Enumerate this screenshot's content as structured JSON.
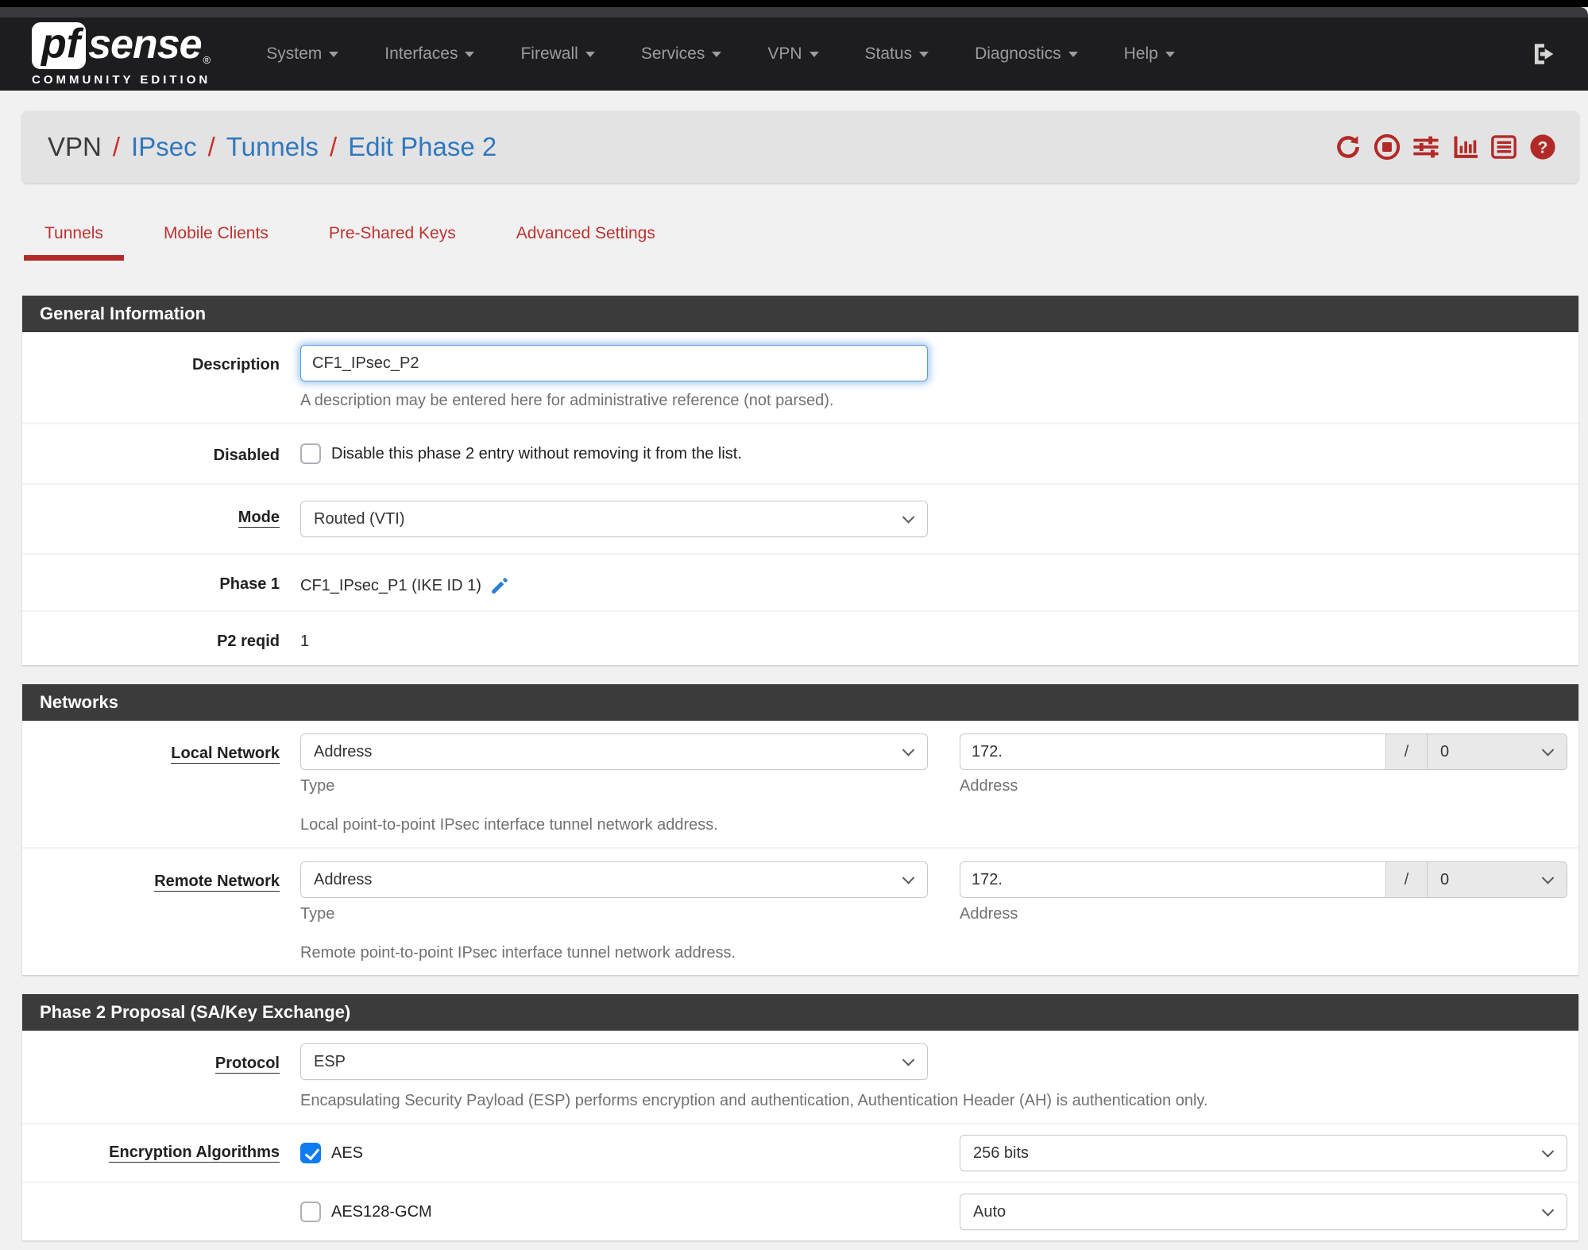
{
  "colors": {
    "accent_red": "#b22a27",
    "link_blue": "#3178be",
    "checkbox_blue": "#0e7bf0",
    "panel_header_bg": "#3b3b3b",
    "navbar_bg": "#1d1d1f"
  },
  "navbar": {
    "brand_pf": "pf",
    "brand_sense": "sense",
    "brand_reg": "®",
    "brand_edition": "COMMUNITY EDITION",
    "items": [
      {
        "label": "System"
      },
      {
        "label": "Interfaces"
      },
      {
        "label": "Firewall"
      },
      {
        "label": "Services"
      },
      {
        "label": "VPN"
      },
      {
        "label": "Status"
      },
      {
        "label": "Diagnostics"
      },
      {
        "label": "Help"
      }
    ]
  },
  "breadcrumb": {
    "sep": "/",
    "items": [
      {
        "label": "VPN"
      },
      {
        "label": "IPsec"
      },
      {
        "label": "Tunnels"
      },
      {
        "label": "Edit Phase 2"
      }
    ],
    "action_icons": [
      "refresh-icon",
      "stop-circle-icon",
      "sliders-icon",
      "bar-chart-icon",
      "list-icon",
      "help-icon"
    ]
  },
  "tabs": [
    {
      "label": "Tunnels",
      "active": true
    },
    {
      "label": "Mobile Clients",
      "active": false
    },
    {
      "label": "Pre-Shared Keys",
      "active": false
    },
    {
      "label": "Advanced Settings",
      "active": false
    }
  ],
  "general": {
    "title": "General Information",
    "description": {
      "label": "Description",
      "value": "CF1_IPsec_P2",
      "help": "A description may be entered here for administrative reference (not parsed)."
    },
    "disabled": {
      "label": "Disabled",
      "checked": false,
      "text": "Disable this phase 2 entry without removing it from the list."
    },
    "mode": {
      "label": "Mode",
      "value": "Routed (VTI)"
    },
    "phase1": {
      "label": "Phase 1",
      "value": "CF1_IPsec_P1 (IKE ID 1)"
    },
    "p2reqid": {
      "label": "P2 reqid",
      "value": "1"
    }
  },
  "networks": {
    "title": "Networks",
    "local": {
      "label": "Local Network",
      "type_value": "Address",
      "type_caption": "Type",
      "address_value": "172.",
      "address_caption": "Address",
      "slash": "/",
      "prefix_value": "0",
      "help": "Local point-to-point IPsec interface tunnel network address."
    },
    "remote": {
      "label": "Remote Network",
      "type_value": "Address",
      "type_caption": "Type",
      "address_value": "172.",
      "address_caption": "Address",
      "slash": "/",
      "prefix_value": "0",
      "help": "Remote point-to-point IPsec interface tunnel network address."
    }
  },
  "proposal": {
    "title": "Phase 2 Proposal (SA/Key Exchange)",
    "protocol": {
      "label": "Protocol",
      "value": "ESP",
      "help": "Encapsulating Security Payload (ESP) performs encryption and authentication, Authentication Header (AH) is authentication only."
    },
    "encryption": {
      "label": "Encryption Algorithms",
      "rows": [
        {
          "name": "AES",
          "checked": true,
          "keylen": "256 bits"
        },
        {
          "name": "AES128-GCM",
          "checked": false,
          "keylen": "Auto"
        }
      ]
    }
  }
}
